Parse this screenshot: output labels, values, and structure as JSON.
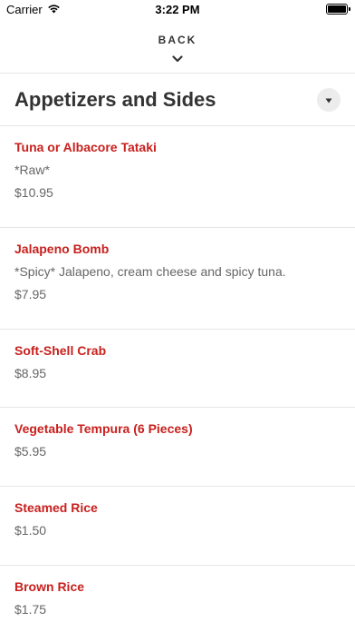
{
  "status_bar": {
    "carrier": "Carrier",
    "time": "3:22 PM",
    "battery_level": 1.0
  },
  "nav": {
    "back_label": "BACK"
  },
  "section": {
    "title": "Appetizers and Sides"
  },
  "items": [
    {
      "name": "Tuna or Albacore Tataki",
      "description": "*Raw*",
      "price": "$10.95"
    },
    {
      "name": "Jalapeno Bomb",
      "description": "*Spicy* Jalapeno, cream cheese and spicy tuna.",
      "price": "$7.95"
    },
    {
      "name": "Soft-Shell Crab",
      "price": "$8.95"
    },
    {
      "name": "Vegetable Tempura (6 Pieces)",
      "price": "$5.95"
    },
    {
      "name": "Steamed Rice",
      "price": "$1.50"
    },
    {
      "name": "Brown Rice",
      "price": "$1.75"
    }
  ],
  "colors": {
    "item_name": "#c8201d",
    "secondary_text": "#666666",
    "divider": "#e5e5e5"
  }
}
